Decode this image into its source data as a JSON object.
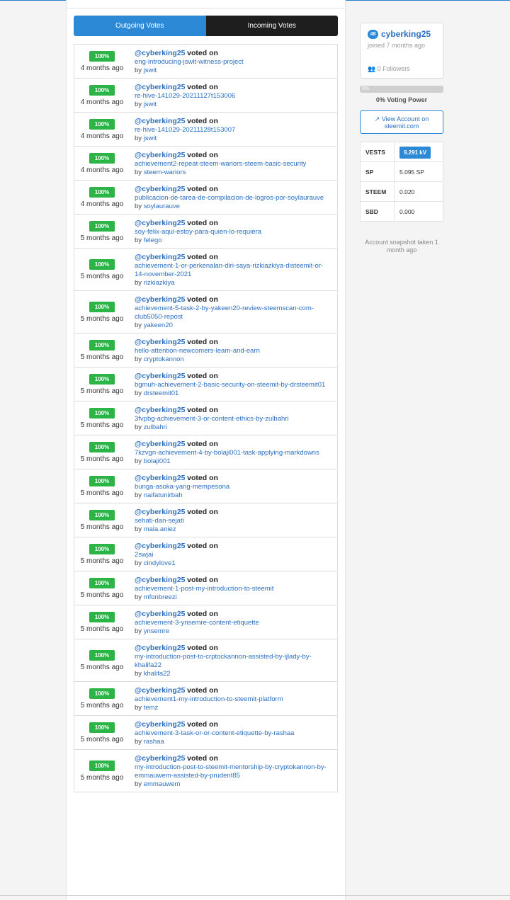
{
  "tabs": {
    "outgoing": "Outgoing Votes",
    "incoming": "Incoming Votes"
  },
  "labels": {
    "voted_on": "voted on",
    "by": "by"
  },
  "votes": [
    {
      "pct": "100%",
      "age": "4 months ago",
      "voter": "@cyberking25",
      "post": "eng-introducing-jswit-witness-project",
      "author": "jswit"
    },
    {
      "pct": "100%",
      "age": "4 months ago",
      "voter": "@cyberking25",
      "post": "re-hive-141029-20211127t153006",
      "author": "jswit"
    },
    {
      "pct": "100%",
      "age": "4 months ago",
      "voter": "@cyberking25",
      "post": "re-hive-141029-20211128t153007",
      "author": "jswit"
    },
    {
      "pct": "100%",
      "age": "4 months ago",
      "voter": "@cyberking25",
      "post": "achievement2-repeat-steem-wariors-steem-basic-security",
      "author": "steem-wariors"
    },
    {
      "pct": "100%",
      "age": "4 months ago",
      "voter": "@cyberking25",
      "post": "publicacion-de-tarea-de-compilacion-de-logros-por-soylaurauve",
      "author": "soylaurauve"
    },
    {
      "pct": "100%",
      "age": "5 months ago",
      "voter": "@cyberking25",
      "post": "soy-felix-aqui-estoy-para-quien-lo-requiera",
      "author": "felego"
    },
    {
      "pct": "100%",
      "age": "5 months ago",
      "voter": "@cyberking25",
      "post": "achievement-1-or-perkenalan-diri-saya-rizkiazkiya-disteemit-or-14-november-2021",
      "author": "rizkiazkiya"
    },
    {
      "pct": "100%",
      "age": "5 months ago",
      "voter": "@cyberking25",
      "post": "achievement-5-task-2-by-yakeen20-review-steemscan-com-club5050-repost",
      "author": "yakeen20"
    },
    {
      "pct": "100%",
      "age": "5 months ago",
      "voter": "@cyberking25",
      "post": "hello-attention-newcomers-learn-and-earn",
      "author": "cryptokannon"
    },
    {
      "pct": "100%",
      "age": "5 months ago",
      "voter": "@cyberking25",
      "post": "bgmuh-achievement-2-basic-security-on-steemit-by-drsteemit01",
      "author": "drsteemit01"
    },
    {
      "pct": "100%",
      "age": "5 months ago",
      "voter": "@cyberking25",
      "post": "3fvpbg-achievement-3-or-content-ethics-by-zulbahri",
      "author": "zulbahri"
    },
    {
      "pct": "100%",
      "age": "5 months ago",
      "voter": "@cyberking25",
      "post": "7kzvgn-achievement-4-by-bolaji001-task-applying-markdowns",
      "author": "bolaji001"
    },
    {
      "pct": "100%",
      "age": "5 months ago",
      "voter": "@cyberking25",
      "post": "bunga-asoka-yang-mempesona",
      "author": "naifatunirbah"
    },
    {
      "pct": "100%",
      "age": "5 months ago",
      "voter": "@cyberking25",
      "post": "sehati-dan-sejati",
      "author": "mala.aniez"
    },
    {
      "pct": "100%",
      "age": "5 months ago",
      "voter": "@cyberking25",
      "post": "2swjai",
      "author": "cindylove1"
    },
    {
      "pct": "100%",
      "age": "5 months ago",
      "voter": "@cyberking25",
      "post": "achievement-1-post-my-introduction-to-steemit",
      "author": "mfonbreezi"
    },
    {
      "pct": "100%",
      "age": "5 months ago",
      "voter": "@cyberking25",
      "post": "achievement-3-ynsemre-content-etiquette",
      "author": "ynsemre"
    },
    {
      "pct": "100%",
      "age": "5 months ago",
      "voter": "@cyberking25",
      "post": "my-introduction-post-to-crptockannon-assisted-by-ijlady-by-khalifa22",
      "author": "khalifa22"
    },
    {
      "pct": "100%",
      "age": "5 months ago",
      "voter": "@cyberking25",
      "post": "achievement1-my-introduction-to-steemit-platform",
      "author": "temz"
    },
    {
      "pct": "100%",
      "age": "5 months ago",
      "voter": "@cyberking25",
      "post": "achievement-3-task-or-or-content-etiquette-by-rashaa",
      "author": "rashaa"
    },
    {
      "pct": "100%",
      "age": "5 months ago",
      "voter": "@cyberking25",
      "post": "my-introduction-post-to-steemit-mentorship-by-cryptokannon-by-emmauwem-assisted-by-prudent85",
      "author": "emmauwem"
    }
  ],
  "profile": {
    "reputation": "48",
    "username": "cyberking25",
    "joined": "joined 7 months ago",
    "followers": "0 Followers",
    "vp_bar_label": "0%",
    "voting_power": "0% Voting Power",
    "view_account": "View Account on steemit.com"
  },
  "balances": [
    {
      "key": "VESTS",
      "value": "9.291 kV"
    },
    {
      "key": "SP",
      "value": "5.095 SP"
    },
    {
      "key": "STEEM",
      "value": "0.020"
    },
    {
      "key": "SBD",
      "value": "0.000"
    }
  ],
  "snapshot": "Account snapshot taken 1 month ago"
}
